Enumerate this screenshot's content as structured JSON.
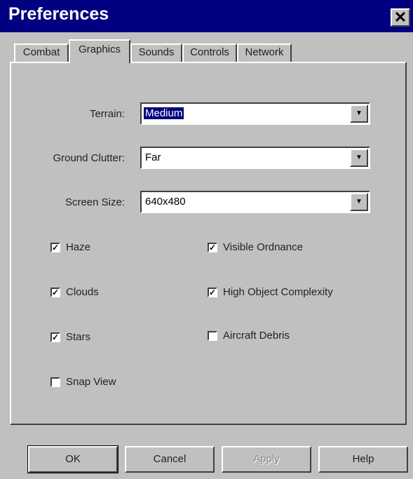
{
  "window": {
    "title": "Preferences",
    "close_glyph": "✕"
  },
  "tabs": [
    {
      "label": "Combat",
      "active": false
    },
    {
      "label": "Graphics",
      "active": true
    },
    {
      "label": "Sounds",
      "active": false
    },
    {
      "label": "Controls",
      "active": false
    },
    {
      "label": "Network",
      "active": false
    }
  ],
  "fields": {
    "terrain": {
      "label": "Terrain:",
      "value": "Medium"
    },
    "ground_clutter": {
      "label": "Ground Clutter:",
      "value": "Far"
    },
    "screen_size": {
      "label": "Screen Size:",
      "value": "640x480"
    }
  },
  "checkboxes": {
    "haze": {
      "label": "Haze",
      "checked": true
    },
    "clouds": {
      "label": "Clouds",
      "checked": true
    },
    "stars": {
      "label": "Stars",
      "checked": true
    },
    "snap_view": {
      "label": "Snap View",
      "checked": false
    },
    "visible_ordnance": {
      "label": "Visible Ordnance",
      "checked": true
    },
    "high_object_complexity": {
      "label": "High Object Complexity",
      "checked": true
    },
    "aircraft_debris": {
      "label": "Aircraft Debris",
      "checked": false
    }
  },
  "buttons": {
    "ok": "OK",
    "cancel": "Cancel",
    "apply": "Apply",
    "help": "Help"
  },
  "glyphs": {
    "check": "✓",
    "dropdown": "▼"
  },
  "colors": {
    "titlebar": "#000080",
    "face": "#c0c0c0",
    "selection": "#000080"
  }
}
